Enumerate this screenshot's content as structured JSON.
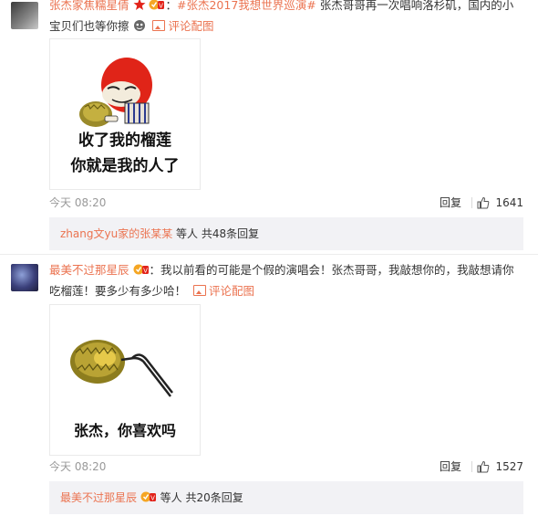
{
  "comments": [
    {
      "user": "张杰家焦糯星倩",
      "colon": "：",
      "topic": "#张杰2017我想世界巡演#",
      "text": " 张杰哥哥再一次唱响洛杉矶，国内的小宝贝们也等你擦",
      "pic_link": "评论配图",
      "image_caption_line1": "收了我的榴莲",
      "image_caption_line2": "你就是我的人了",
      "time": "今天 08:20",
      "reply_label": "回复",
      "likes": "1641",
      "replies_user": "zhang文yu家的张某某",
      "replies_text": "等人 共48条回复"
    },
    {
      "user": "最美不过那星辰",
      "colon": "：",
      "text": "我以前看的可能是个假的演唱会！张杰哥哥，我敲想你的，我敲想请你吃榴莲！要多少有多少哈！",
      "pic_link": "评论配图",
      "image_caption": "张杰，你喜欢吗",
      "time": "今天 08:20",
      "reply_label": "回复",
      "likes": "1527",
      "replies_user": "最美不过那星辰",
      "replies_text": "等人 共20条回复"
    }
  ],
  "colors": {
    "accent": "#eb7350",
    "reply_bg": "#f2f2f5"
  }
}
